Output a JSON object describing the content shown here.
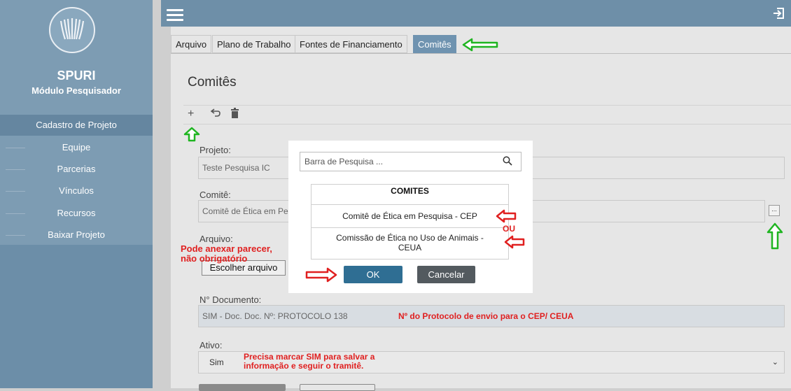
{
  "sidebar": {
    "app_title": "SPURI",
    "app_subtitle": "Módulo Pesquisador",
    "items": [
      {
        "label": "Cadastro de Projeto"
      },
      {
        "label": "Equipe"
      },
      {
        "label": "Parcerias"
      },
      {
        "label": "Vínculos"
      },
      {
        "label": "Recursos"
      },
      {
        "label": "Baixar Projeto"
      }
    ]
  },
  "tabs": [
    {
      "label": "Arquivo"
    },
    {
      "label": "Plano de Trabalho"
    },
    {
      "label": "Fontes de Financiamento"
    },
    {
      "label": "Comitês"
    }
  ],
  "page": {
    "title": "Comitês"
  },
  "form": {
    "projeto_label": "Projeto:",
    "projeto_value": "Teste Pesquisa IC",
    "comite_label": "Comitê:",
    "comite_value": "Comitê de Ética em Pe",
    "ellipsis": "...",
    "arquivo_label": "Arquivo:",
    "file_button": "Escolher arquivo",
    "doc_label": "N° Documento:",
    "doc_value": "SIM - Doc. Doc. Nº: PROTOCOLO 138",
    "ativo_label": "Ativo:",
    "ativo_value": "Sim"
  },
  "notes": {
    "anexar_line1": "Pode anexar parecer,",
    "anexar_line2": "não obrigatório",
    "protocolo": "Nº do Protocolo de envio para o CEP/ CEUA",
    "sim_line1": "Precisa marcar SIM para salvar a",
    "sim_line2": "informação e seguir o tramitê.",
    "ou": "OU"
  },
  "modal": {
    "search_placeholder": "Barra de Pesquisa ...",
    "list_header": "COMITES",
    "options": [
      {
        "label": "Comitê de Ética em Pesquisa - CEP"
      },
      {
        "label_line1": "Comissão de Ética no Uso de Animais -",
        "label_line2": "CEUA"
      }
    ],
    "ok_label": "OK",
    "cancel_label": "Cancelar"
  },
  "icons": {
    "menu": "hamburger-icon",
    "logout": "logout-icon",
    "add": "plus-icon",
    "undo": "undo-icon",
    "delete": "trash-icon",
    "search": "search-icon",
    "select": "chevron-down-icon"
  },
  "colors": {
    "sidebar": "#7d9cb3",
    "topbar": "#6e8fa8",
    "active_tab": "#6f93b0",
    "ok_button": "#2f6e93",
    "cancel_button": "#535a5f",
    "annotation_red": "#e02020",
    "annotation_green": "#1fb521"
  }
}
